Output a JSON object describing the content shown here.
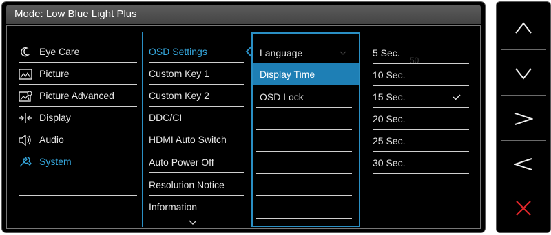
{
  "header": {
    "mode_label": "Mode:",
    "mode_value": "Low Blue Light Plus"
  },
  "main_menu": [
    {
      "label": "Eye Care",
      "icon": "eye-care-icon"
    },
    {
      "label": "Picture",
      "icon": "picture-icon"
    },
    {
      "label": "Picture Advanced",
      "icon": "picture-advanced-icon"
    },
    {
      "label": "Display",
      "icon": "display-icon"
    },
    {
      "label": "Audio",
      "icon": "audio-icon"
    },
    {
      "label": "System",
      "icon": "system-icon",
      "active": true
    }
  ],
  "system_menu": [
    {
      "label": "OSD Settings",
      "active": true
    },
    {
      "label": "Custom Key 1"
    },
    {
      "label": "Custom Key 2"
    },
    {
      "label": "DDC/CI"
    },
    {
      "label": "HDMI Auto Switch"
    },
    {
      "label": "Auto Power Off"
    },
    {
      "label": "Resolution Notice"
    },
    {
      "label": "Information"
    }
  ],
  "osd_settings_menu": [
    {
      "label": "Language"
    },
    {
      "label": "Display Time",
      "highlighted": true
    },
    {
      "label": "OSD Lock"
    }
  ],
  "display_time_options": [
    {
      "label": "5 Sec."
    },
    {
      "label": "10 Sec."
    },
    {
      "label": "15 Sec.",
      "selected": true
    },
    {
      "label": "20 Sec."
    },
    {
      "label": "25 Sec."
    },
    {
      "label": "30 Sec."
    }
  ],
  "ghost_value": "50",
  "side_buttons": [
    {
      "name": "up-button",
      "icon": "chevron-up-icon"
    },
    {
      "name": "down-button",
      "icon": "chevron-down-icon"
    },
    {
      "name": "right-button",
      "icon": "chevron-right-icon"
    },
    {
      "name": "left-button",
      "icon": "chevron-left-icon"
    },
    {
      "name": "exit-button",
      "icon": "close-icon"
    }
  ],
  "colors": {
    "accent": "#2a8fc4",
    "highlight": "#1e7fb5",
    "active_text": "#35a7dd",
    "exit": "#e0262a"
  }
}
